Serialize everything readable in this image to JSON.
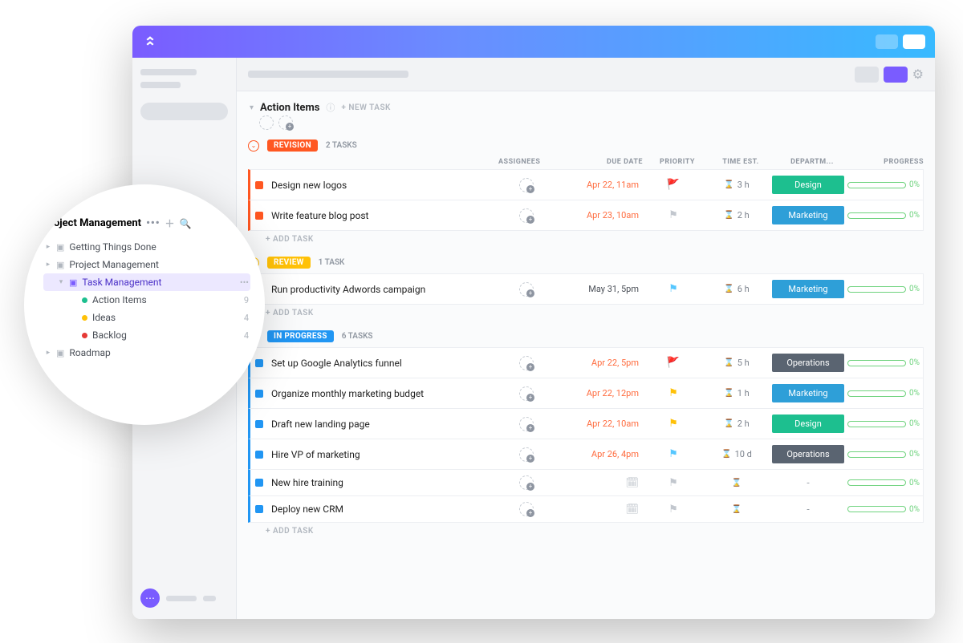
{
  "app": {
    "name": "ClickUp"
  },
  "list": {
    "title": "Action Items",
    "new_task": "+ NEW TASK"
  },
  "columns": {
    "assignees": "ASSIGNEES",
    "due": "DUE DATE",
    "priority": "PRIORITY",
    "time": "TIME EST.",
    "dept": "DEPARTM...",
    "progress": "PROGRESS"
  },
  "add_task": "+ ADD TASK",
  "groups": [
    {
      "name": "REVISION",
      "count": "2 TASKS",
      "color": "#ff5722",
      "tasks": [
        {
          "name": "Design new logos",
          "due": "Apr 22, 11am",
          "due_color": "#ff6b3e",
          "flag": "🚩",
          "flag_color": "#ff3e3e",
          "time": "3 h",
          "dept": "Design",
          "dept_color": "#1dbf8f",
          "progress": "0%"
        },
        {
          "name": "Write feature blog post",
          "due": "Apr 23, 10am",
          "due_color": "#ff6b3e",
          "flag": "⚑",
          "flag_color": "#c2c7ce",
          "time": "2 h",
          "dept": "Marketing",
          "dept_color": "#2e9fd8",
          "progress": "0%"
        }
      ]
    },
    {
      "name": "REVIEW",
      "count": "1 TASK",
      "color": "#ffc107",
      "tasks": [
        {
          "name": "Run productivity Adwords campaign",
          "due": "May 31, 5pm",
          "due_color": "#4a4f57",
          "flag": "⚑",
          "flag_color": "#56c7ff",
          "time": "6 h",
          "dept": "Marketing",
          "dept_color": "#2e9fd8",
          "progress": "0%"
        }
      ]
    },
    {
      "name": "IN PROGRESS",
      "count": "6 TASKS",
      "color": "#2196f3",
      "tasks": [
        {
          "name": "Set up Google Analytics funnel",
          "due": "Apr 22, 5pm",
          "due_color": "#ff6b3e",
          "flag": "🚩",
          "flag_color": "#ff3e3e",
          "time": "5 h",
          "dept": "Operations",
          "dept_color": "#5a6471",
          "progress": "0%"
        },
        {
          "name": "Organize monthly marketing budget",
          "due": "Apr 22, 12pm",
          "due_color": "#ff6b3e",
          "flag": "⚑",
          "flag_color": "#ffc107",
          "time": "1 h",
          "dept": "Marketing",
          "dept_color": "#2e9fd8",
          "progress": "0%"
        },
        {
          "name": "Draft new landing page",
          "due": "Apr 22, 10am",
          "due_color": "#ff6b3e",
          "flag": "⚑",
          "flag_color": "#ffc107",
          "time": "2 h",
          "dept": "Design",
          "dept_color": "#1dbf8f",
          "progress": "0%"
        },
        {
          "name": "Hire VP of marketing",
          "due": "Apr 26, 4pm",
          "due_color": "#ff6b3e",
          "flag": "⚑",
          "flag_color": "#56c7ff",
          "time": "10 d",
          "dept": "Operations",
          "dept_color": "#5a6471",
          "progress": "0%"
        },
        {
          "name": "New hire training",
          "due": "",
          "due_color": "",
          "flag": "⚑",
          "flag_color": "#c2c7ce",
          "time": "",
          "dept": "-",
          "dept_color": "",
          "progress": "0%",
          "empty": true
        },
        {
          "name": "Deploy new CRM",
          "due": "",
          "due_color": "",
          "flag": "⚑",
          "flag_color": "#c2c7ce",
          "time": "",
          "dept": "-",
          "dept_color": "",
          "progress": "0%",
          "empty": true
        }
      ]
    }
  ],
  "zoom": {
    "title": "Project Management",
    "items": [
      {
        "type": "folder",
        "label": "Getting Things Done",
        "indent": 0,
        "caret": "▸"
      },
      {
        "type": "folder",
        "label": "Project Management",
        "indent": 0,
        "caret": "▸"
      },
      {
        "type": "folder",
        "label": "Task Management",
        "indent": 1,
        "caret": "▾",
        "active": true,
        "more": "•••"
      },
      {
        "type": "list",
        "label": "Action Items",
        "indent": 2,
        "bullet": "#1dbf8f",
        "count": "9"
      },
      {
        "type": "list",
        "label": "Ideas",
        "indent": 2,
        "bullet": "#ffc107",
        "count": "4"
      },
      {
        "type": "list",
        "label": "Backlog",
        "indent": 2,
        "bullet": "#e53935",
        "count": "4"
      },
      {
        "type": "folder",
        "label": "Roadmap",
        "indent": 0,
        "caret": "▸"
      }
    ]
  }
}
